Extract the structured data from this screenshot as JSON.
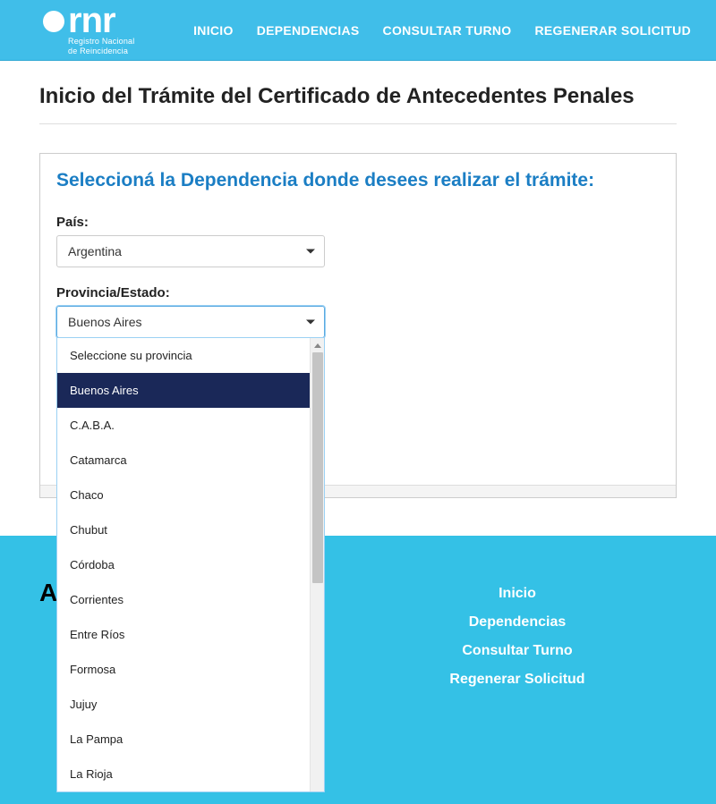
{
  "header": {
    "logo_text": "rnr",
    "logo_sub1": "Registro Nacional",
    "logo_sub2": "de Reincidencia",
    "nav": {
      "inicio": "INICIO",
      "dependencias": "DEPENDENCIAS",
      "consultar": "CONSULTAR TURNO",
      "regenerar": "REGENERAR SOLICITUD"
    }
  },
  "page_title": "Inicio del Trámite del Certificado de Antecedentes Penales",
  "panel": {
    "title": "Seleccioná la Dependencia donde desees realizar el trámite:",
    "pais_label": "País:",
    "pais_value": "Argentina",
    "prov_label": "Provincia/Estado:",
    "prov_value": "Buenos Aires",
    "prov_options": [
      "Seleccione su provincia",
      "Buenos Aires",
      "C.A.B.A.",
      "Catamarca",
      "Chaco",
      "Chubut",
      "Córdoba",
      "Corrientes",
      "Entre Ríos",
      "Formosa",
      "Jujuy",
      "La Pampa",
      "La Rioja"
    ],
    "prov_selected_index": 1
  },
  "footer": {
    "left_initial": "A",
    "links": {
      "inicio": "Inicio",
      "dependencias": "Dependencias",
      "consultar": "Consultar Turno",
      "regenerar": "Regenerar Solicitud"
    }
  }
}
